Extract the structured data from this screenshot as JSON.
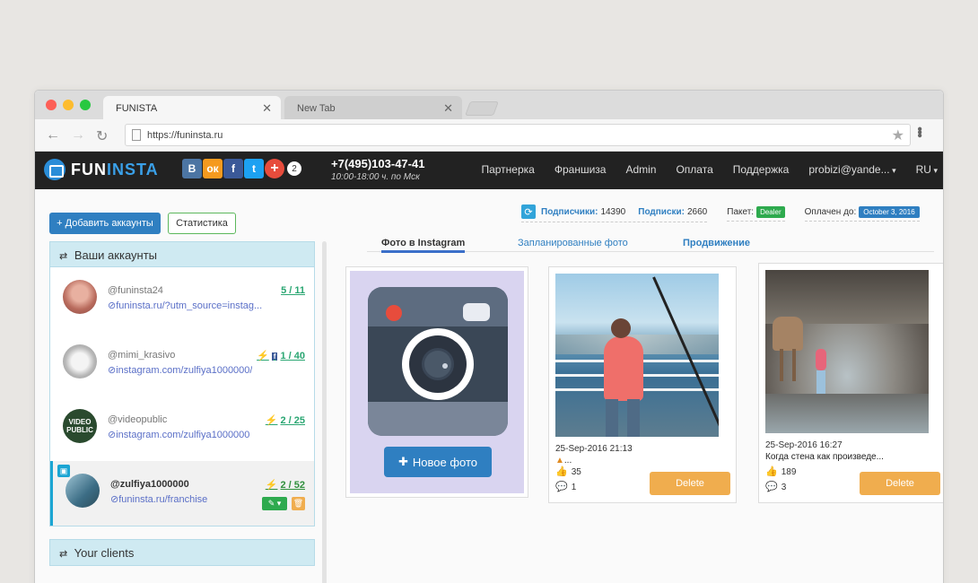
{
  "browser": {
    "tabs": [
      {
        "label": "FUNISTA"
      },
      {
        "label": "New Tab"
      }
    ],
    "url": "https://funinsta.ru"
  },
  "navbar": {
    "logo": {
      "part1": "FUN",
      "part2": "INSTA"
    },
    "socials": [
      "В",
      "ок",
      "f",
      "t",
      "+"
    ],
    "social_count": "2",
    "phone": "+7(495)103-47-41",
    "hours": "10:00-18:00 ч. по Мск",
    "menu": [
      "Партнерка",
      "Франшиза",
      "Admin",
      "Оплата",
      "Поддержка",
      "probizi@yande...",
      "RU"
    ]
  },
  "toolbar": {
    "add_accounts": "+ Добавить аккаунты",
    "statistics": "Статистика"
  },
  "stats": {
    "followers_label": "Подписчики:",
    "followers_value": "14390",
    "following_label": "Подписки:",
    "following_value": "2660",
    "package_label": "Пакет:",
    "package_value": "Dealer",
    "paid_until_label": "Оплачен до:",
    "paid_until_value": "October 3, 2016"
  },
  "accounts_panel": {
    "title": "Ваши аккаунты",
    "accounts": [
      {
        "username": "@funinsta24",
        "link": "funinsta.ru/?utm_source=instag...",
        "count": "5 / 11"
      },
      {
        "username": "@mimi_krasivo",
        "link": "instagram.com/zulfiya1000000/",
        "count": "1 / 40"
      },
      {
        "username": "@videopublic",
        "link": "instagram.com/zulfiya1000000",
        "count": "2 / 25"
      },
      {
        "username": "@zulfiya1000000",
        "link": "funinsta.ru/franchise",
        "count": "2 / 52"
      }
    ],
    "avatar_text": "VIDEO PUBLIC"
  },
  "clients_panel": {
    "title": "Your clients"
  },
  "content_tabs": [
    "Фото в Instagram",
    "Запланированные фото",
    "Продвижение"
  ],
  "new_photo": {
    "label": "Новое фото"
  },
  "posts": [
    {
      "date": "25-Sep-2016 21:13",
      "caption": "...",
      "likes": "35",
      "comments": "1",
      "delete": "Delete"
    },
    {
      "date": "25-Sep-2016 16:27",
      "caption": "Когда стена как произведе...",
      "likes": "189",
      "comments": "3",
      "delete": "Delete"
    }
  ],
  "colors": {
    "primary": "#2f7fc1",
    "navbar_bg": "#222222",
    "panel_header": "#cfeaf2",
    "delete": "#f0ad4e",
    "success": "#2eaa4e"
  }
}
